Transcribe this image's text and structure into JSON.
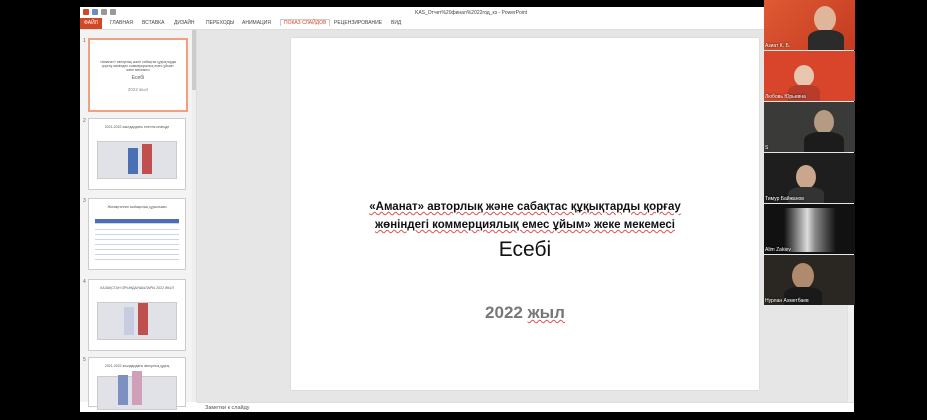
{
  "window": {
    "title": "KAS_Отчет%20финал%2022год_кз - PowerPoint"
  },
  "ribbon": {
    "tabs": [
      "ФАЙЛ",
      "ГЛАВНАЯ",
      "ВСТАВКА",
      "ДИЗАЙН",
      "ПЕРЕХОДЫ",
      "АНИМАЦИЯ",
      "ПОКАЗ СЛАЙДОВ",
      "РЕЦЕНЗИРОВАНИЕ",
      "ВИД"
    ]
  },
  "thumbnails": {
    "numbers": [
      "1",
      "2",
      "3",
      "4",
      "5"
    ],
    "t1_line1": "«Аманат» авторлық және сабақтас құқықтарды қорғау жөніндегі коммерциялық емес ұйым» жеке мекемесі",
    "t1_word": "Есебі",
    "t1_year": "2022 жыл",
    "t2_title": "2021-2022 жылдардағы есептік кезеңде",
    "t3_title": "Жинақталған сыйақының құрылымы",
    "t4_title": "КАЗАҚСТАН ОРЫНДАУШЫЛАРЫ 2022 ЖЫЛ",
    "t5_title": "2021-2022 жылдардағы авторлық құқық"
  },
  "slide": {
    "line1": "«Аманат» авторлық және сабақтас құқықтарды қорғау",
    "line2": "жөніндегі коммерциялық емес ұйым» жеке мекемесі",
    "word": "Есебі",
    "year_num": "2022",
    "year_word": "жыл"
  },
  "notes": {
    "placeholder": "Заметки к слайду"
  },
  "participants": [
    {
      "name": "Азиат К. Б."
    },
    {
      "name": "Любовь Юрьевна"
    },
    {
      "name": "S"
    },
    {
      "name": "Тимур Байжанов"
    },
    {
      "name": "Alim Zakiev"
    },
    {
      "name": "Нурлан Ахметбаев"
    }
  ],
  "colors": {
    "accent": "#d24726",
    "tile_red": "#d8452a"
  }
}
